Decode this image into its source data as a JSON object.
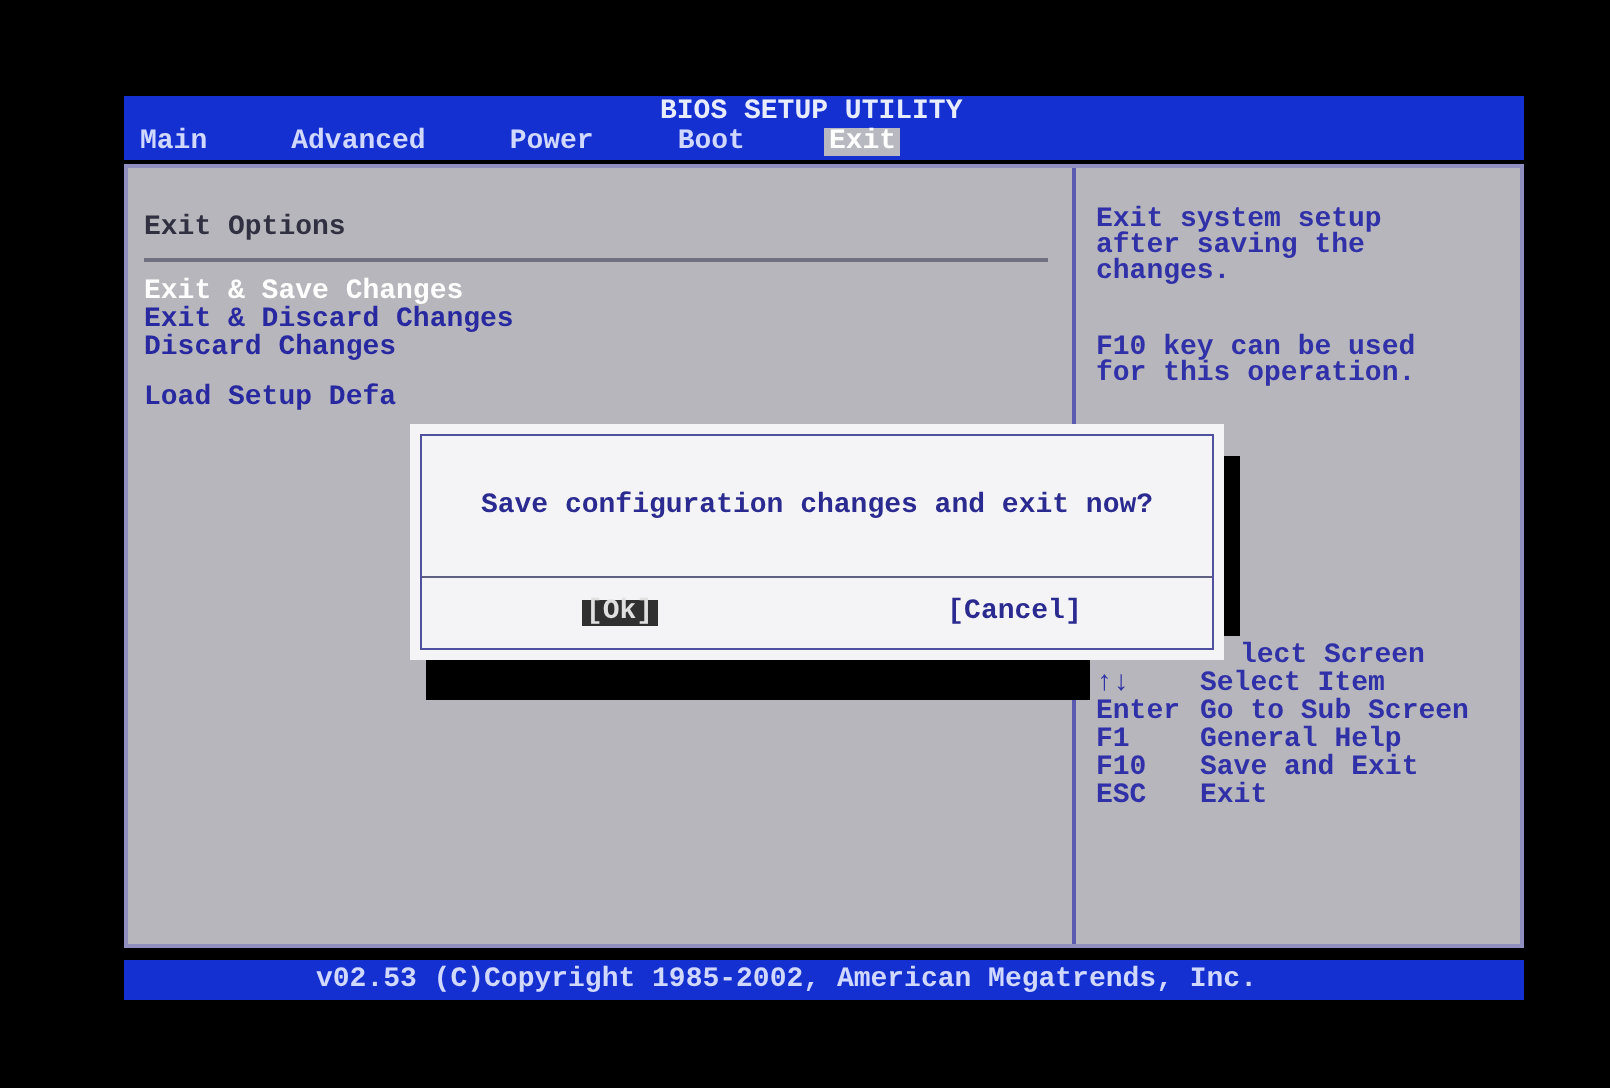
{
  "header": {
    "title": "BIOS SETUP UTILITY"
  },
  "tabs": [
    {
      "label": "Main",
      "selected": false
    },
    {
      "label": "Advanced",
      "selected": false
    },
    {
      "label": "Power",
      "selected": false
    },
    {
      "label": "Boot",
      "selected": false
    },
    {
      "label": "Exit",
      "selected": true
    }
  ],
  "section_title": "Exit Options",
  "menu_items": [
    {
      "label": "Exit & Save Changes",
      "selected": true
    },
    {
      "label": "Exit & Discard Changes",
      "selected": false
    },
    {
      "label": "Discard Changes",
      "selected": false
    },
    {
      "label": "Load Setup Defa",
      "selected": false
    }
  ],
  "help_text": [
    "Exit system setup after saving the changes.",
    "F10 key can be used for this operation."
  ],
  "key_legend": [
    {
      "text": "lect Screen"
    },
    {
      "key": "↑↓",
      "text": "Select Item"
    },
    {
      "key": "Enter",
      "text": "Go to Sub Screen"
    },
    {
      "key": "F1",
      "text": "General Help"
    },
    {
      "key": "F10",
      "text": "Save and Exit"
    },
    {
      "key": "ESC",
      "text": "Exit"
    }
  ],
  "dialog": {
    "message": "Save configuration changes and exit now?",
    "buttons": [
      {
        "label": "[Ok]",
        "selected": true
      },
      {
        "label": "[Cancel]",
        "selected": false
      }
    ]
  },
  "footer": "v02.53 (C)Copyright 1985-2002, American Megatrends, Inc."
}
